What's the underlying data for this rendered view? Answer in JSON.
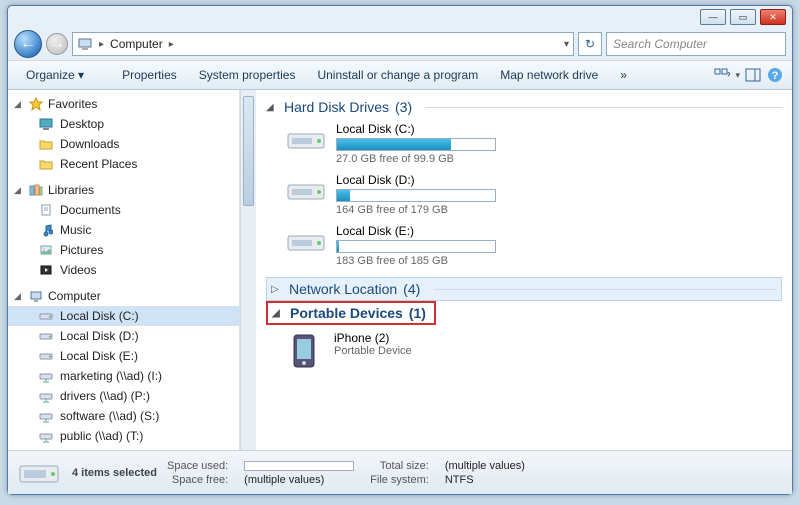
{
  "titlebar": {
    "min": "—",
    "max": "▭",
    "close": "✕"
  },
  "nav": {
    "back": "←",
    "fwd": "→",
    "dropdown": "▾",
    "refresh": "↻"
  },
  "breadcrumb": {
    "root_icon": "computer",
    "current": "Computer",
    "sep": "▸"
  },
  "search": {
    "placeholder": "Search Computer"
  },
  "toolbar": {
    "organize": "Organize ▾",
    "properties": "Properties",
    "sysprops": "System properties",
    "uninstall": "Uninstall or change a program",
    "mapdrive": "Map network drive",
    "more": "»"
  },
  "sidebar": {
    "favorites": {
      "label": "Favorites",
      "items": [
        "Desktop",
        "Downloads",
        "Recent Places"
      ]
    },
    "libraries": {
      "label": "Libraries",
      "items": [
        "Documents",
        "Music",
        "Pictures",
        "Videos"
      ]
    },
    "computer": {
      "label": "Computer",
      "items": [
        "Local Disk (C:)",
        "Local Disk (D:)",
        "Local Disk (E:)",
        "marketing (\\\\ad) (I:)",
        "drivers (\\\\ad) (P:)",
        "software (\\\\ad) (S:)",
        "public (\\\\ad) (T:)"
      ]
    }
  },
  "groups": {
    "hdd": {
      "label": "Hard Disk Drives",
      "count": "(3)"
    },
    "net": {
      "label": "Network Location",
      "count": "(4)"
    },
    "portable": {
      "label": "Portable Devices",
      "count": "(1)"
    }
  },
  "drives": [
    {
      "name": "Local Disk (C:)",
      "free": "27.0 GB free of 99.9 GB",
      "fill": 72
    },
    {
      "name": "Local Disk (D:)",
      "free": "164 GB free of 179 GB",
      "fill": 8
    },
    {
      "name": "Local Disk (E:)",
      "free": "183 GB free of 185 GB",
      "fill": 1
    }
  ],
  "portable_device": {
    "name": "iPhone (2)",
    "type": "Portable Device"
  },
  "status": {
    "selection": "4 items selected",
    "space_used_label": "Space used:",
    "space_free_label": "Space free:",
    "space_free_val": "(multiple values)",
    "total_label": "Total size:",
    "total_val": "(multiple values)",
    "fs_label": "File system:",
    "fs_val": "NTFS"
  }
}
